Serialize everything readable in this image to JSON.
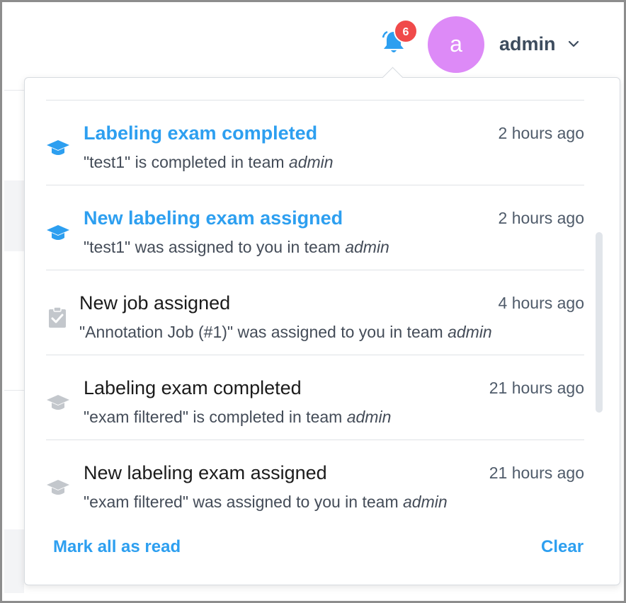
{
  "header": {
    "notification_count": "6",
    "avatar_initial": "a",
    "username": "admin"
  },
  "colors": {
    "accent": "#2d9ff0",
    "badge": "#f04a4a",
    "avatar": "#dd8af7",
    "read_icon": "#c3c7cc"
  },
  "notifications": [
    {
      "icon": "graduation-cap-icon",
      "unread": true,
      "title": "Labeling exam completed",
      "time": "2 hours ago",
      "desc_prefix": "\"test1\" is completed in team ",
      "desc_team": "admin"
    },
    {
      "icon": "graduation-cap-icon",
      "unread": true,
      "title": "New labeling exam assigned",
      "time": "2 hours ago",
      "desc_prefix": "\"test1\" was assigned to you in team ",
      "desc_team": "admin"
    },
    {
      "icon": "clipboard-check-icon",
      "unread": false,
      "title": "New job assigned",
      "time": "4 hours ago",
      "desc_prefix": "\"Annotation Job (#1)\" was assigned to you in team ",
      "desc_team": "admin"
    },
    {
      "icon": "graduation-cap-icon",
      "unread": false,
      "title": "Labeling exam completed",
      "time": "21 hours ago",
      "desc_prefix": "\"exam filtered\" is completed in team ",
      "desc_team": "admin"
    },
    {
      "icon": "graduation-cap-icon",
      "unread": false,
      "title": "New labeling exam assigned",
      "time": "21 hours ago",
      "desc_prefix": "\"exam filtered\" was assigned to you in team ",
      "desc_team": "admin"
    }
  ],
  "footer": {
    "mark_all": "Mark all as read",
    "clear": "Clear"
  }
}
